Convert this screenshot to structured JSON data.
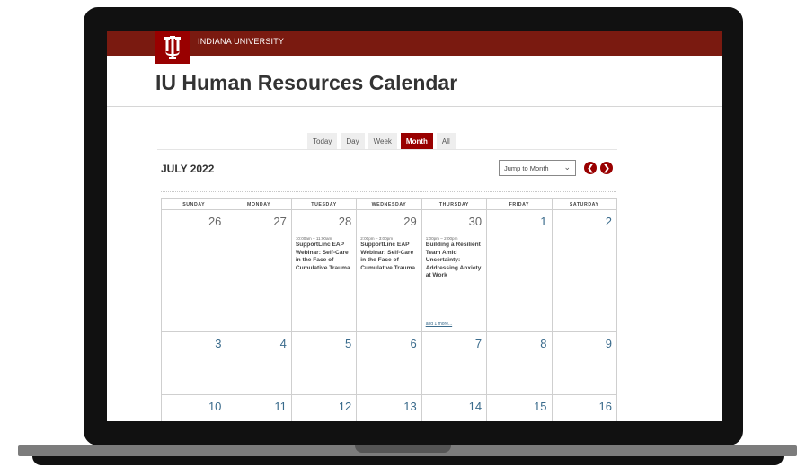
{
  "header": {
    "university_name": "INDIANA UNIVERSITY",
    "page_title": "IU Human Resources Calendar"
  },
  "view_tabs": [
    {
      "label": "Today",
      "active": false
    },
    {
      "label": "Day",
      "active": false
    },
    {
      "label": "Week",
      "active": false
    },
    {
      "label": "Month",
      "active": true
    },
    {
      "label": "All",
      "active": false
    }
  ],
  "calendar": {
    "month_label": "JULY 2022",
    "jump_select": {
      "value": "Jump to Month"
    },
    "prev_icon": "chevron-left-circle",
    "next_icon": "chevron-right-circle",
    "weekdays": [
      "SUNDAY",
      "MONDAY",
      "TUESDAY",
      "WEDNESDAY",
      "THURSDAY",
      "FRIDAY",
      "SATURDAY"
    ],
    "weeks": [
      [
        {
          "day": "26",
          "current": false,
          "events": []
        },
        {
          "day": "27",
          "current": false,
          "events": []
        },
        {
          "day": "28",
          "current": false,
          "events": [
            {
              "time": "10:00am – 11:00am",
              "title": "SupportLinc EAP Webinar: Self-Care in the Face of Cumulative Trauma"
            }
          ]
        },
        {
          "day": "29",
          "current": false,
          "events": [
            {
              "time": "2:00pm – 3:00pm",
              "title": "SupportLinc EAP Webinar: Self-Care in the Face of Cumulative Trauma"
            }
          ]
        },
        {
          "day": "30",
          "current": false,
          "events": [
            {
              "time": "1:00pm – 2:00pm",
              "title": "Building a Resilient Team Amid Uncertainty: Addressing Anxiety at Work"
            }
          ],
          "more": "and 1 more..."
        },
        {
          "day": "1",
          "current": true,
          "events": []
        },
        {
          "day": "2",
          "current": true,
          "events": []
        }
      ],
      [
        {
          "day": "3",
          "current": true,
          "events": []
        },
        {
          "day": "4",
          "current": true,
          "events": []
        },
        {
          "day": "5",
          "current": true,
          "events": []
        },
        {
          "day": "6",
          "current": true,
          "events": []
        },
        {
          "day": "7",
          "current": true,
          "events": []
        },
        {
          "day": "8",
          "current": true,
          "events": []
        },
        {
          "day": "9",
          "current": true,
          "events": []
        }
      ],
      [
        {
          "day": "10",
          "current": true,
          "events": []
        },
        {
          "day": "11",
          "current": true,
          "events": []
        },
        {
          "day": "12",
          "current": true,
          "events": []
        },
        {
          "day": "13",
          "current": true,
          "events": []
        },
        {
          "day": "14",
          "current": true,
          "events": []
        },
        {
          "day": "15",
          "current": true,
          "events": []
        },
        {
          "day": "16",
          "current": true,
          "events": []
        }
      ]
    ]
  },
  "colors": {
    "brand_crimson": "#990000",
    "header_bar": "#7a1a10",
    "day_number_current": "#3a6b8c",
    "day_number_other": "#666666"
  }
}
